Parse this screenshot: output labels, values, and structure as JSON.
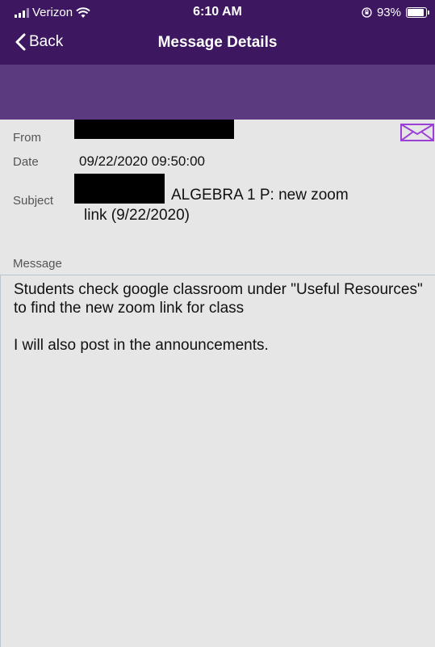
{
  "status_bar": {
    "carrier": "Verizon",
    "time": "6:10 AM",
    "battery": "93%",
    "battery_level": 0.93
  },
  "nav": {
    "back_label": "Back",
    "title": "Message Details"
  },
  "details": {
    "from_label": "From",
    "date_label": "Date",
    "date_value": "09/22/2020 09:50:00",
    "subject_label": "Subject",
    "subject_line1": "ALGEBRA 1 P: new zoom",
    "subject_line2": "link (9/22/2020)",
    "mail_icon": "envelope-icon"
  },
  "message": {
    "label": "Message",
    "paragraph1": "Students check google classroom under \"Useful Resources\" to find the new zoom link for class",
    "paragraph2": "I will also post in the announcements."
  }
}
